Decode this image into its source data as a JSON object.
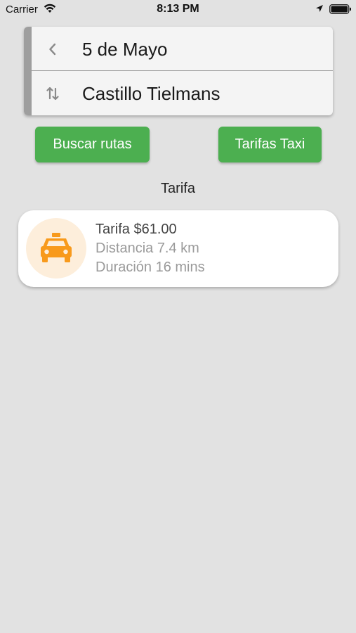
{
  "status_bar": {
    "carrier": "Carrier",
    "time": "8:13 PM"
  },
  "route": {
    "origin": "5 de Mayo",
    "destination": "Castillo Tielmans"
  },
  "buttons": {
    "search_routes": "Buscar rutas",
    "taxi_fares": "Tarifas Taxi"
  },
  "section_label": "Tarifa",
  "fare": {
    "price": "Tarifa $61.00",
    "distance": "Distancia 7.4 km",
    "duration": "Duración 16 mins"
  },
  "colors": {
    "accent_green": "#4caf50",
    "taxi_orange": "#f89a1c",
    "background": "#e2e2e2"
  },
  "icons": {
    "back": "chevron-left-icon",
    "swap": "swap-vertical-icon",
    "taxi": "taxi-icon"
  }
}
